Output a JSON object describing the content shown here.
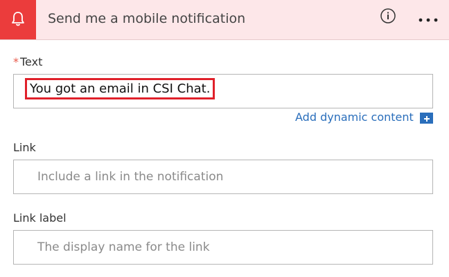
{
  "header": {
    "title": "Send me a mobile notification",
    "icon": "bell-icon",
    "accent_color": "#eb3c3c",
    "background_color": "#fde7e9"
  },
  "fields": {
    "text": {
      "required_marker": "*",
      "label": "Text",
      "value": "You got an email in CSI Chat."
    },
    "link": {
      "label": "Link",
      "placeholder": "Include a link in the notification"
    },
    "link_label": {
      "label": "Link label",
      "placeholder": "The display name for the link"
    }
  },
  "dynamic_content": {
    "label": "Add dynamic content",
    "color": "#2a6ebb"
  }
}
